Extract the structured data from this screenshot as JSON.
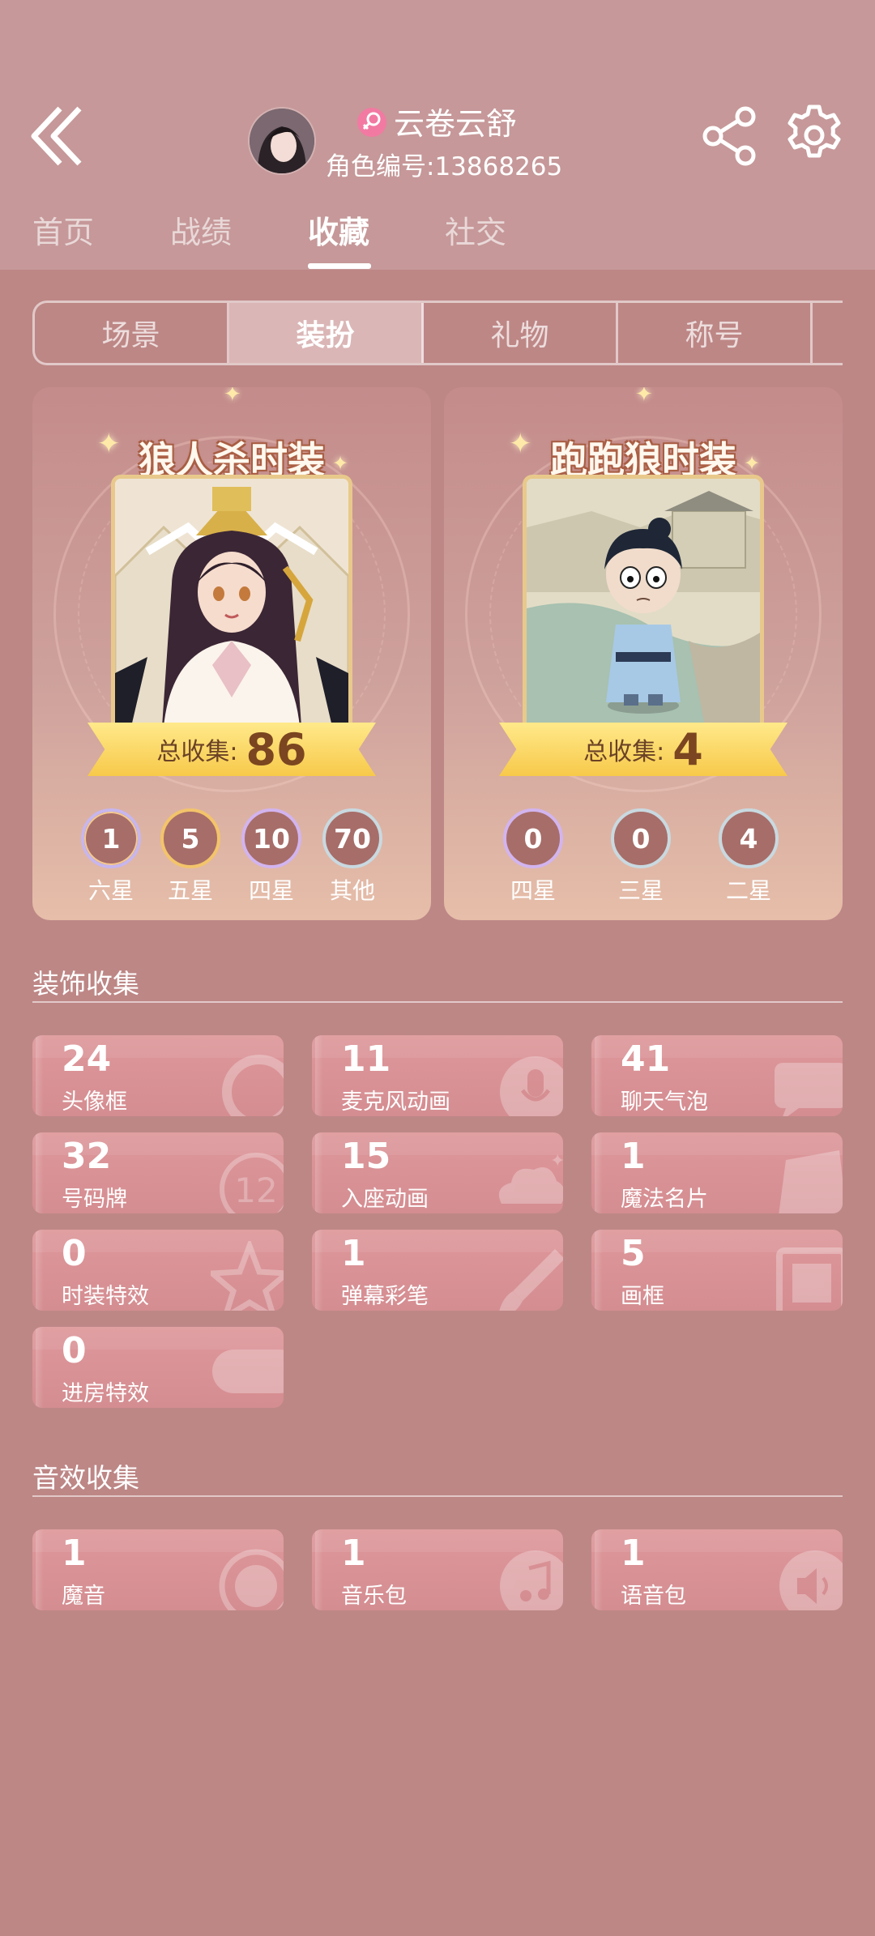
{
  "header": {
    "player_name": "云卷云舒",
    "player_id_label": "角色编号:",
    "player_id": "13868265",
    "gender_color": "#f06a9a"
  },
  "main_tabs": [
    {
      "label": "首页",
      "active": false
    },
    {
      "label": "战绩",
      "active": false
    },
    {
      "label": "收藏",
      "active": true
    },
    {
      "label": "社交",
      "active": false
    }
  ],
  "sub_tabs": [
    {
      "label": "场景",
      "active": false
    },
    {
      "label": "装扮",
      "active": true
    },
    {
      "label": "礼物",
      "active": false
    },
    {
      "label": "称号",
      "active": false
    }
  ],
  "cards": [
    {
      "title": "狼人杀时装",
      "total_label": "总收集:",
      "total": "86",
      "stars": [
        {
          "count": "1",
          "label": "六星"
        },
        {
          "count": "5",
          "label": "五星"
        },
        {
          "count": "10",
          "label": "四星"
        },
        {
          "count": "70",
          "label": "其他"
        }
      ]
    },
    {
      "title": "跑跑狼时装",
      "total_label": "总收集:",
      "total": "4",
      "stars": [
        {
          "count": "0",
          "label": "四星"
        },
        {
          "count": "0",
          "label": "三星"
        },
        {
          "count": "4",
          "label": "二星"
        }
      ]
    }
  ],
  "decoration": {
    "title": "装饰收集",
    "items": [
      {
        "value": "24",
        "label": "头像框",
        "icon": "avatar-frame-icon"
      },
      {
        "value": "11",
        "label": "麦克风动画",
        "icon": "microphone-icon"
      },
      {
        "value": "41",
        "label": "聊天气泡",
        "icon": "chat-bubble-icon"
      },
      {
        "value": "32",
        "label": "号码牌",
        "icon": "number-plate-icon"
      },
      {
        "value": "15",
        "label": "入座动画",
        "icon": "cloud-icon"
      },
      {
        "value": "1",
        "label": "魔法名片",
        "icon": "name-card-icon"
      },
      {
        "value": "0",
        "label": "时装特效",
        "icon": "star-effect-icon"
      },
      {
        "value": "1",
        "label": "弹幕彩笔",
        "icon": "brush-icon"
      },
      {
        "value": "5",
        "label": "画框",
        "icon": "picture-frame-icon"
      },
      {
        "value": "0",
        "label": "进房特效",
        "icon": "entry-effect-icon"
      }
    ]
  },
  "sound": {
    "title": "音效收集",
    "items": [
      {
        "value": "1",
        "label": "魔音",
        "icon": "magic-voice-icon"
      },
      {
        "value": "1",
        "label": "音乐包",
        "icon": "music-note-icon"
      },
      {
        "value": "1",
        "label": "语音包",
        "icon": "speaker-icon"
      }
    ]
  },
  "colors": {
    "background": "#bd8786",
    "header": "#c69899",
    "tile": "#d99296",
    "ribbon": "#f7c94a"
  }
}
